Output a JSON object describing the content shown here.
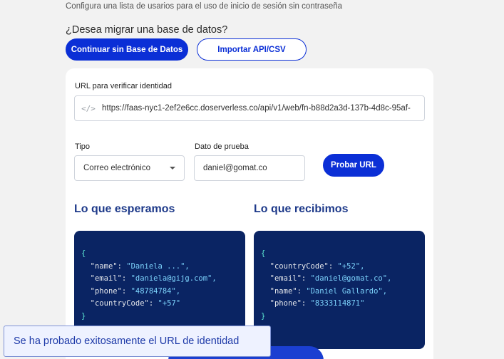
{
  "header": {
    "subtitle": "Configura una lista de usarios para el uso de inicio de sesión sin contraseña",
    "migrate_question": "¿Desea migrar una base de datos?",
    "continue_button": "Continuar sin Base de Datos",
    "import_button": "Importar API/CSV"
  },
  "form": {
    "url_label": "URL para verificar identidad",
    "url_icon": "</>",
    "url_value": "https://faas-nyc1-2ef2e6cc.doserverless.co/api/v1/web/fn-b88d2a3d-137b-4d8c-95af-",
    "type_label": "Tipo",
    "type_value": "Correo electrónico",
    "test_label": "Dato de prueba",
    "test_value": "daniel@gomat.co",
    "test_button": "Probar URL"
  },
  "expected": {
    "title": "Lo que esperamos",
    "open": "{",
    "close": "}",
    "lines": [
      {
        "key": "\"name\"",
        "value": "\"Daniela ...\","
      },
      {
        "key": "\"email\"",
        "value": "\"daniela@gijg.com\","
      },
      {
        "key": "\"phone\"",
        "value": "\"48784784\","
      },
      {
        "key": "\"countryCode\"",
        "value": "\"+57\""
      }
    ]
  },
  "received": {
    "title": "Lo que recibimos",
    "open": "{",
    "close": "}",
    "lines": [
      {
        "key": "\"countryCode\"",
        "value": "\"+52\","
      },
      {
        "key": "\"email\"",
        "value": "\"daniel@gomat.co\","
      },
      {
        "key": "\"name\"",
        "value": "\"Daniel Gallardo\","
      },
      {
        "key": "\"phone\"",
        "value": "\"8333114871\""
      }
    ]
  },
  "toast": {
    "message": "Se ha probado exitosamente el URL de identidad"
  },
  "colors": {
    "primary": "#0b2fd6",
    "code_bg": "#0a2463",
    "title": "#1e3a8a"
  }
}
